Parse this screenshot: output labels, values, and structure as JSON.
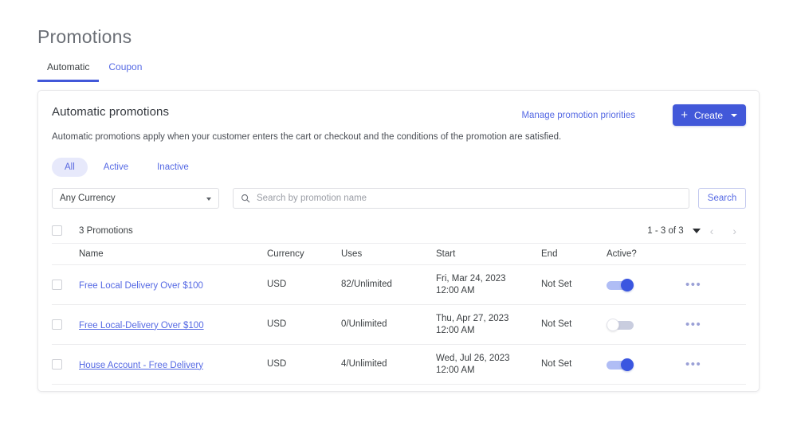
{
  "page": {
    "title": "Promotions"
  },
  "tabs": [
    {
      "label": "Automatic",
      "active": true
    },
    {
      "label": "Coupon",
      "active": false
    }
  ],
  "card": {
    "title": "Automatic promotions",
    "subtitle": "Automatic promotions apply when your customer enters the cart or checkout and the conditions of the promotion are satisfied.",
    "manage_link": "Manage promotion priorities",
    "create_button": {
      "label": "Create",
      "plus_icon": "plus-icon",
      "caret_icon": "chevron-down-icon",
      "color": "#4258d9"
    }
  },
  "filters": {
    "pills": [
      {
        "label": "All",
        "selected": true
      },
      {
        "label": "Active",
        "selected": false
      },
      {
        "label": "Inactive",
        "selected": false
      }
    ],
    "currency_select": {
      "value": "Any Currency",
      "caret_icon": "chevron-down-icon"
    },
    "search": {
      "placeholder": "Search by promotion name",
      "value": "",
      "icon": "search-icon"
    },
    "search_button": "Search"
  },
  "toolbar": {
    "count_label": "3 Promotions",
    "pager_text": "1 - 3 of 3",
    "pager_caret": "chevron-down-icon",
    "prev_arrow": "‹",
    "next_arrow": "›"
  },
  "table": {
    "columns": {
      "name": "Name",
      "currency": "Currency",
      "uses": "Uses",
      "start": "Start",
      "end": "End",
      "active": "Active?"
    },
    "rows": [
      {
        "name": "Free Local Delivery Over $100",
        "name_underlined": false,
        "currency": "USD",
        "uses": "82/Unlimited",
        "start_date": "Fri, Mar 24, 2023",
        "start_time": "12:00 AM",
        "end": "Not Set",
        "active": true,
        "menu_icon": "kebab-menu-icon"
      },
      {
        "name": "Free Local-Delivery Over $100",
        "name_underlined": true,
        "currency": "USD",
        "uses": "0/Unlimited",
        "start_date": "Thu, Apr 27, 2023",
        "start_time": "12:00 AM",
        "end": "Not Set",
        "active": false,
        "menu_icon": "kebab-menu-icon"
      },
      {
        "name": "House Account - Free Delivery",
        "name_underlined": true,
        "currency": "USD",
        "uses": "4/Unlimited",
        "start_date": "Wed, Jul 26, 2023",
        "start_time": "12:00 AM",
        "end": "Not Set",
        "active": true,
        "menu_icon": "kebab-menu-icon"
      }
    ]
  },
  "colors": {
    "accent": "#4258d9",
    "link": "#5569e4",
    "pill_selected_bg": "#e7e9fb",
    "toggle_on": "#3a56e0"
  }
}
